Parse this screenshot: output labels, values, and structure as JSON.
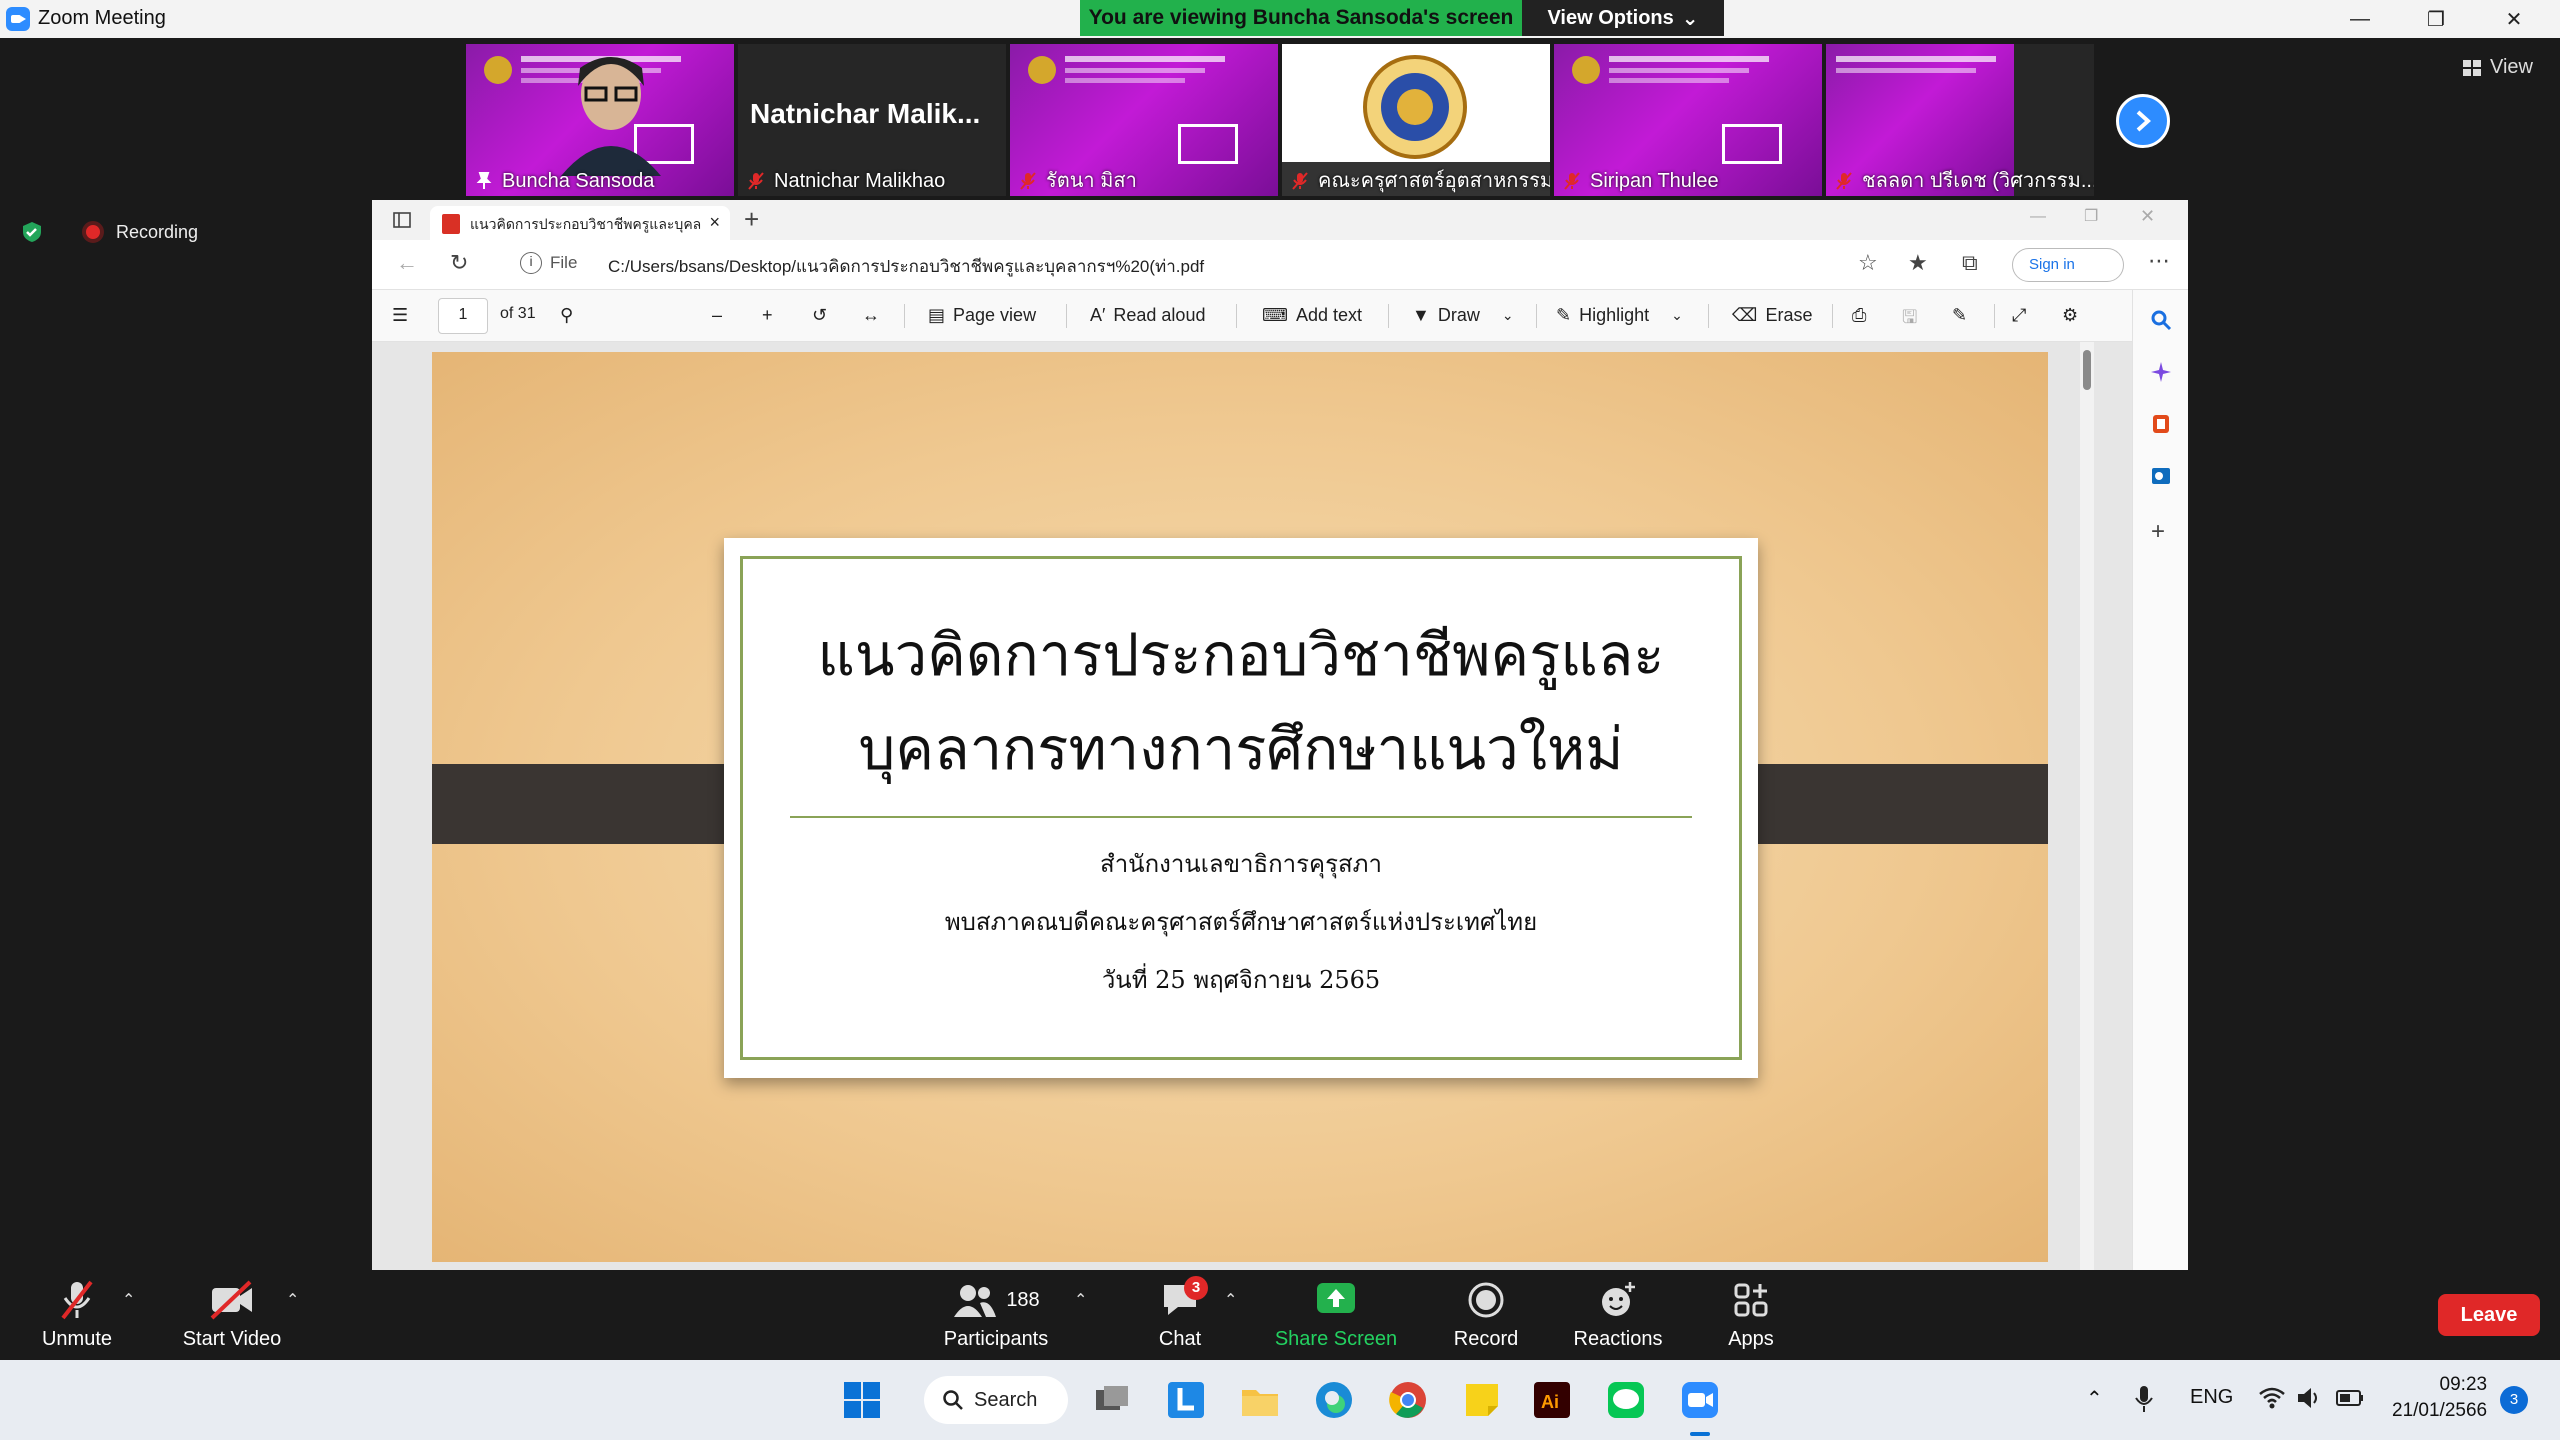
{
  "window": {
    "title": "Zoom Meeting"
  },
  "banner": {
    "viewing_text": "You are viewing Buncha Sansoda's screen",
    "view_options": "View Options"
  },
  "participants_strip": [
    {
      "name": "Buncha Sansoda",
      "type": "video"
    },
    {
      "name": "Natnichar Malikhao",
      "display_name": "Natnichar  Malik...",
      "type": "name"
    },
    {
      "name": "รัตนา มิสา",
      "type": "slide"
    },
    {
      "name": "คณะครุศาสตร์อุตสาหกรรม...",
      "type": "seal"
    },
    {
      "name": "Siripan Thulee",
      "type": "slide"
    },
    {
      "name": "ชลลดา ปรีเดช (วิศวกรรม...",
      "type": "slide"
    }
  ],
  "view_button": "View",
  "recording": {
    "label": "Recording"
  },
  "browser": {
    "tab_title": "แนวคิดการประกอบวิชาชีพครูและบุคล",
    "file_label": "File",
    "url": "C:/Users/bsans/Desktop/แนวคิดการประกอบวิชาชีพครูและบุคลากรฯ%20(ท่า.pdf",
    "sign_in": "Sign in",
    "toolbar": {
      "page_current": "1",
      "page_total": "of 31",
      "page_view": "Page view",
      "read_aloud": "Read aloud",
      "add_text": "Add text",
      "draw": "Draw",
      "highlight": "Highlight",
      "erase": "Erase"
    }
  },
  "slide": {
    "title_line1": "แนวคิดการประกอบวิชาชีพครูและ",
    "title_line2": "บุคลากรทางการศึกษาแนวใหม่",
    "sub1": "สำนักงานเลขาธิการคุรุสภา",
    "sub2": "พบสภาคณบดีคณะครุศาสตร์ศึกษาศาสตร์แห่งประเทศไทย",
    "sub3": "วันที่ 25 พฤศจิกายน 2565"
  },
  "controls": {
    "unmute": "Unmute",
    "start_video": "Start Video",
    "participants": "Participants",
    "participants_count": "188",
    "chat": "Chat",
    "chat_badge": "3",
    "share_screen": "Share Screen",
    "record": "Record",
    "reactions": "Reactions",
    "apps": "Apps",
    "leave": "Leave"
  },
  "taskbar": {
    "search": "Search",
    "language": "ENG",
    "time": "09:23",
    "date": "21/01/2566",
    "notifications": "3"
  },
  "colors": {
    "banner_green": "#22b14c",
    "zoom_blue": "#2d8cff",
    "leave_red": "#e02828",
    "slide_frame": "#8aa357"
  }
}
